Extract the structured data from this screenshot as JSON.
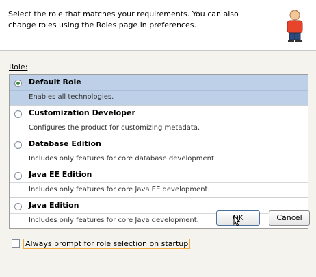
{
  "header": {
    "description": "Select the role that matches your requirements. You can also change roles using the Roles page in preferences."
  },
  "role_label": "Role:",
  "roles": [
    {
      "name": "Default Role",
      "description": "Enables all technologies.",
      "selected": true
    },
    {
      "name": "Customization Developer",
      "description": "Configures the product for customizing metadata.",
      "selected": false
    },
    {
      "name": "Database Edition",
      "description": "Includes only features for core database development.",
      "selected": false
    },
    {
      "name": "Java EE Edition",
      "description": "Includes only features for core Java EE development.",
      "selected": false
    },
    {
      "name": "Java Edition",
      "description": "Includes only features for core Java development.",
      "selected": false
    }
  ],
  "always_prompt": {
    "label": "Always prompt for role selection on startup",
    "checked": false
  },
  "buttons": {
    "ok": "OK",
    "cancel": "Cancel"
  },
  "colors": {
    "selected_row": "#bed0e7",
    "focus_border": "#f3a840",
    "radio_dot": "#3a8a3a"
  },
  "icons": {
    "header": "user-icon"
  }
}
